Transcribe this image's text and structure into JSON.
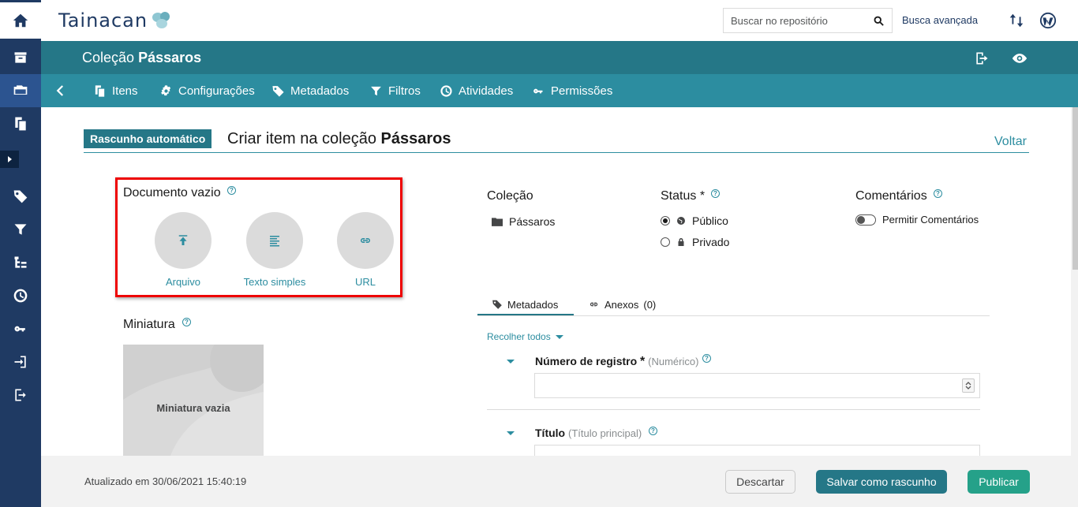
{
  "header": {
    "logo_text": "Tainacan",
    "search_placeholder": "Buscar no repositório",
    "advanced_search": "Busca avançada"
  },
  "collection": {
    "prefix": "Coleção",
    "name": "Pássaros"
  },
  "subnav": {
    "items": [
      {
        "label": "Itens",
        "icon": "items-icon"
      },
      {
        "label": "Configurações",
        "icon": "gear-icon"
      },
      {
        "label": "Metadados",
        "icon": "tags-icon"
      },
      {
        "label": "Filtros",
        "icon": "filter-icon"
      },
      {
        "label": "Atividades",
        "icon": "activity-icon"
      },
      {
        "label": "Permissões",
        "icon": "key-icon"
      }
    ]
  },
  "page": {
    "draft_badge": "Rascunho automático",
    "heading_prefix": "Criar item na coleção",
    "heading_collection": "Pássaros",
    "back_link": "Voltar"
  },
  "document": {
    "label": "Documento vazio",
    "options": [
      {
        "label": "Arquivo",
        "icon": "upload-icon"
      },
      {
        "label": "Texto simples",
        "icon": "text-icon"
      },
      {
        "label": "URL",
        "icon": "link-icon"
      }
    ]
  },
  "thumbnail": {
    "label": "Miniatura",
    "empty_label": "Miniatura vazia"
  },
  "meta": {
    "collection_label": "Coleção",
    "collection_value": "Pássaros",
    "status_label": "Status",
    "required_mark": "*",
    "status_public": "Público",
    "status_private": "Privado",
    "comments_label": "Comentários",
    "comments_toggle": "Permitir Comentários"
  },
  "tabs": {
    "metadata": "Metadados",
    "attachments": "Anexos",
    "attachments_count": "(0)"
  },
  "fields": {
    "collapse_all": "Recolher todos",
    "registration_label": "Número de registro",
    "registration_required": "*",
    "registration_type": "(Numérico)",
    "title_label": "Título",
    "title_type": "(Título principal)"
  },
  "footer": {
    "updated": "Atualizado em 30/06/2021 15:40:19",
    "discard": "Descartar",
    "save_draft": "Salvar como rascunho",
    "publish": "Publicar"
  },
  "colors": {
    "sidebar": "#1f3a63",
    "collection_bar": "#257787",
    "subnav": "#2c8da0",
    "publish": "#25a189",
    "highlight": "#ee0000"
  }
}
